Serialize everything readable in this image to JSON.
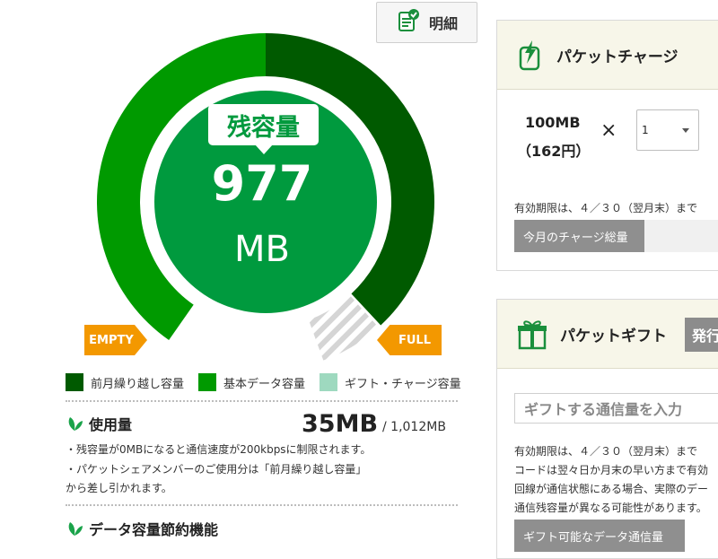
{
  "detail_button": {
    "label": "明細",
    "icon": "document-check-icon"
  },
  "gauge": {
    "remaining_label": "残容量",
    "remaining_value": "977",
    "remaining_unit": "MB",
    "empty_label": "EMPTY",
    "full_label": "FULL",
    "used_fraction": 0.035,
    "colors": {
      "carryover": "#005a00",
      "basic": "#009a00",
      "gift": "#c8c8c8",
      "center": "#009a3e"
    }
  },
  "legend": [
    {
      "label": "前月繰り越し容量",
      "color": "#005a00"
    },
    {
      "label": "基本データ容量",
      "color": "#009a00"
    },
    {
      "label": "ギフト・チャージ容量",
      "color": "#9ed9bf"
    }
  ],
  "usage": {
    "title": "使用量",
    "value": "35MB",
    "total": "/ 1,012MB",
    "notes": [
      "・残容量が0MBになると通信速度が200kbpsに制限されます。",
      "・パケットシェアメンバーのご使用分は「前月繰り越し容量」",
      "から差し引かれます。"
    ]
  },
  "saving": {
    "title": "データ容量節約機能"
  },
  "packet_charge": {
    "title": "パケットチャージ",
    "icon": "phone-charge-icon",
    "amount": "100MB",
    "price": "（162円）",
    "multiply": "×",
    "quantity": "1",
    "validity": "有効期限は、４／３０（翌月末）まで",
    "monthly_total_label": "今月のチャージ総量"
  },
  "packet_gift": {
    "title": "パケットギフト",
    "icon": "gift-box-icon",
    "issue_button": "発行",
    "input_placeholder": "ギフトする通信量を入力",
    "notes": [
      "有効期限は、４／３０（翌月末）まで",
      "コードは翌々日か月末の早い方まで有効",
      "回線が通信状態にある場合、実際のデー",
      "通信残容量が異なる可能性があります。"
    ],
    "available_label": "ギフト可能なデータ通信量"
  }
}
